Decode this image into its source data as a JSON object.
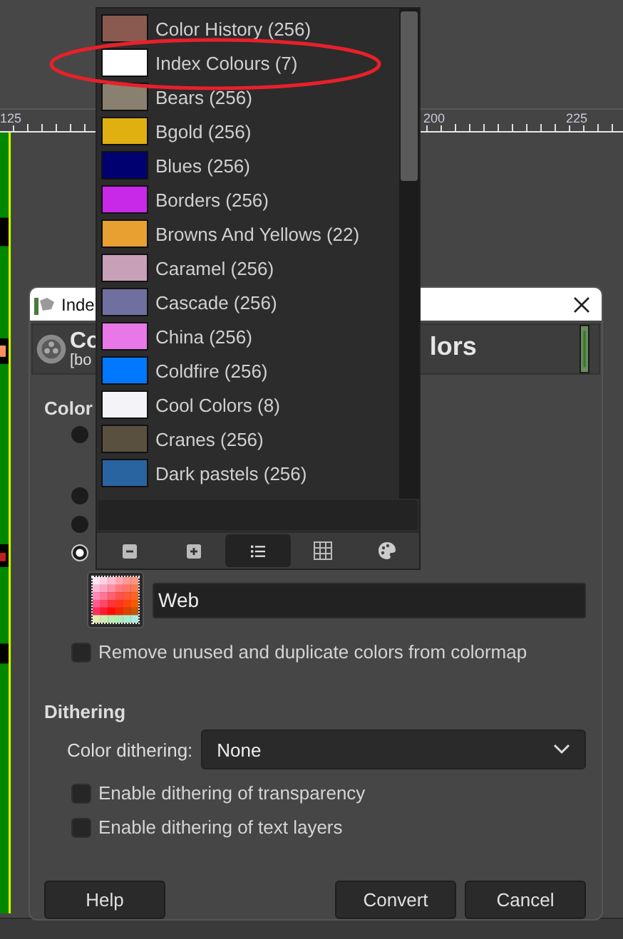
{
  "ruler": {
    "labels": [
      "125",
      "200",
      "225"
    ]
  },
  "dialog": {
    "title": "Inde",
    "header_title_start": "Co",
    "header_title_end": "lors",
    "header_subtitle": "[bo",
    "colormap_heading": "Color",
    "radios": [
      {
        "selected": false
      },
      {
        "selected": false
      },
      {
        "selected": false
      },
      {
        "selected": true
      }
    ],
    "palette_name": "Web",
    "remove_unused": {
      "label": "Remove unused and duplicate colors from colormap",
      "checked": false
    },
    "dithering_heading": "Dithering",
    "color_dithering": {
      "label": "Color dithering:",
      "value": "None"
    },
    "options": [
      {
        "label": "Enable dithering of transparency",
        "checked": false
      },
      {
        "label": "Enable dithering of text layers",
        "checked": false
      }
    ],
    "buttons": [
      "Help",
      "Convert",
      "Cancel"
    ]
  },
  "palette_popup": {
    "items": [
      {
        "name": "Color History (256)",
        "color": "#8a5a50"
      },
      {
        "name": "Index Colours (7)",
        "color": "#ffffff"
      },
      {
        "name": "Bears (256)",
        "color": "#8a8070"
      },
      {
        "name": "Bgold (256)",
        "color": "#e0b010"
      },
      {
        "name": "Blues (256)",
        "color": "#000070"
      },
      {
        "name": "Borders (256)",
        "color": "#c828e8"
      },
      {
        "name": "Browns And Yellows (22)",
        "color": "#e8a030"
      },
      {
        "name": "Caramel (256)",
        "color": "#c8a0b8"
      },
      {
        "name": "Cascade (256)",
        "color": "#7070a0"
      },
      {
        "name": "China (256)",
        "color": "#e878e8"
      },
      {
        "name": "Coldfire (256)",
        "color": "#0078ff"
      },
      {
        "name": "Cool Colors (8)",
        "color": "#f4f4f8"
      },
      {
        "name": "Cranes (256)",
        "color": "#5a5040"
      },
      {
        "name": "Dark pastels (256)",
        "color": "#2a64a0"
      }
    ],
    "toolbar": [
      {
        "kind": "minus",
        "selected": false
      },
      {
        "kind": "plus",
        "selected": false
      },
      {
        "kind": "list",
        "selected": true
      },
      {
        "kind": "grid",
        "selected": false
      },
      {
        "kind": "palette",
        "selected": false
      }
    ]
  }
}
